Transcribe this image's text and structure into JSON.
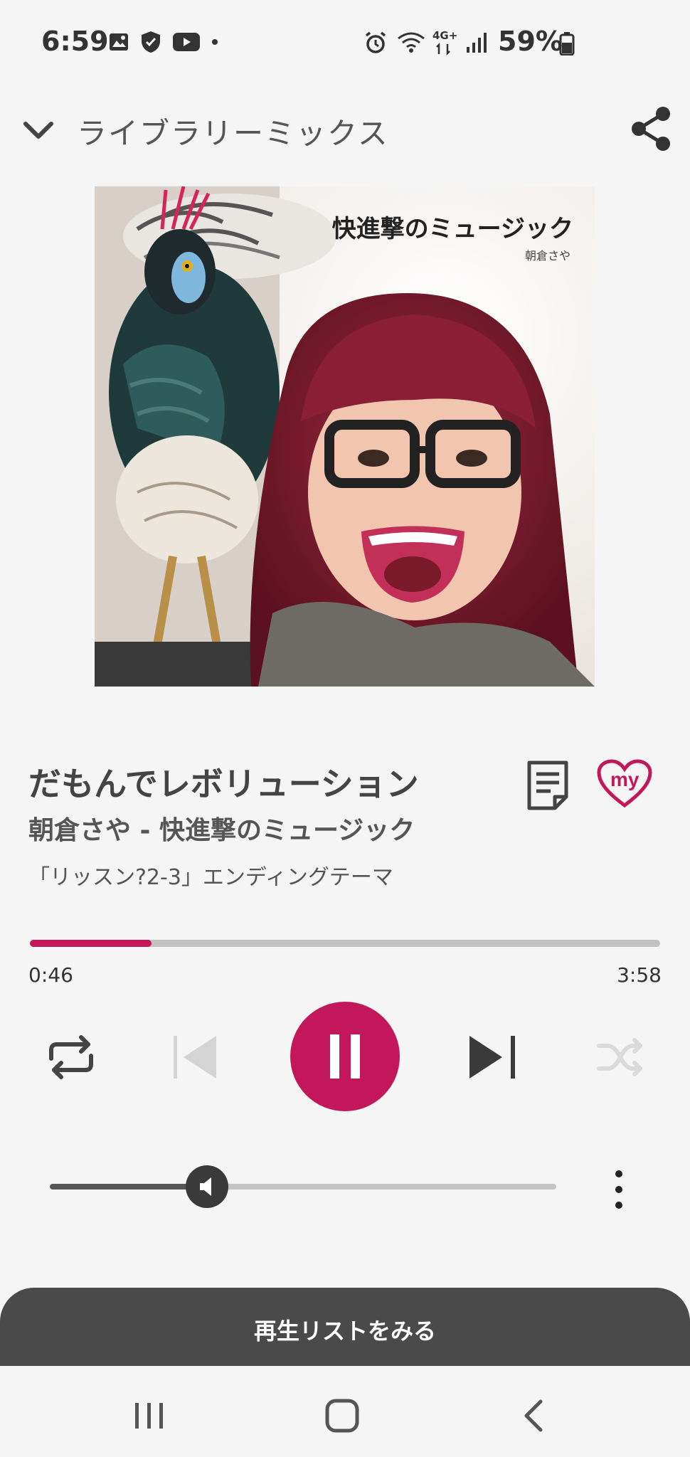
{
  "status_bar": {
    "time": "6:59",
    "network": "4G+",
    "battery": "59%"
  },
  "header": {
    "title": "ライブラリーミックス"
  },
  "album": {
    "title": "快進撃のミュージック",
    "artist": "朝倉さや"
  },
  "track": {
    "title": "だもんでレボリューション",
    "artist_album": "朝倉さや - 快進撃のミュージック",
    "subtitle": "「リッスン?2-3」エンディングテーマ",
    "my_label": "my"
  },
  "progress": {
    "elapsed": "0:46",
    "total": "3:58",
    "fraction": 0.193
  },
  "volume": {
    "fraction": 0.31
  },
  "playlist": {
    "label": "再生リストをみる"
  },
  "colors": {
    "accent": "#c2185b",
    "bar": "#4a4a4a"
  }
}
